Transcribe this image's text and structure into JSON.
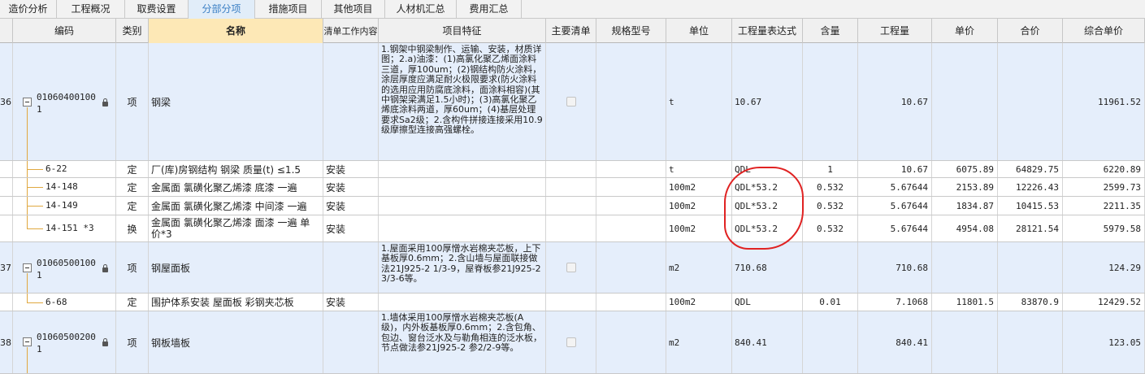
{
  "tabs": [
    {
      "label": "造价分析"
    },
    {
      "label": "工程概况"
    },
    {
      "label": "取费设置"
    },
    {
      "label": "分部分项"
    },
    {
      "label": "措施项目"
    },
    {
      "label": "其他项目"
    },
    {
      "label": "人材机汇总"
    },
    {
      "label": "费用汇总"
    }
  ],
  "grid": {
    "headers": {
      "code": "编码",
      "type": "类别",
      "name": "名称",
      "content": "清单工作内容",
      "feature": "项目特征",
      "main": "主要清单",
      "spec": "规格型号",
      "unit": "单位",
      "expr": "工程量表达式",
      "amount": "含量",
      "quantity": "工程量",
      "price": "单价",
      "total": "合价",
      "unit_total": "综合单价"
    },
    "rows": [
      {
        "seq": "36",
        "code1": "01060400100",
        "code2": "1",
        "type": "项",
        "name": "钢梁",
        "content": "",
        "feature": "1.钢架中钢梁制作、运输、安装，材质详图；2.a)油漆：(1)高氯化聚乙烯面涂料三道，厚100um；(2)钢结构防火涂料，涂层厚度应满足耐火极限要求(防火涂料的选用应用防腐底涂料，面涂料相容)(其中钢架梁满足1.5小时)；(3)高氯化聚乙烯底涂料两道，厚60um；(4)基层处理要求Sa2级；2.含构件拼接连接采用10.9级摩擦型连接高强螺栓。",
        "unit": "t",
        "expr": "10.67",
        "amount": "",
        "quantity": "10.67",
        "price": "",
        "total": "",
        "unit_total": "11961.52"
      },
      {
        "code": "6-22",
        "type": "定",
        "name": "厂(库)房钢结构 钢梁 质量(t) ≤1.5",
        "content": "安装",
        "unit": "t",
        "expr": "QDL",
        "amount": "1",
        "quantity": "10.67",
        "price": "6075.89",
        "total": "64829.75",
        "unit_total": "6220.89"
      },
      {
        "code": "14-148",
        "type": "定",
        "name": "金属面 氯磺化聚乙烯漆 底漆 一遍",
        "content": "安装",
        "unit": "100m2",
        "expr": "QDL*53.2",
        "amount": "0.532",
        "quantity": "5.67644",
        "price": "2153.89",
        "total": "12226.43",
        "unit_total": "2599.73"
      },
      {
        "code": "14-149",
        "type": "定",
        "name": "金属面 氯磺化聚乙烯漆 中间漆 一遍",
        "content": "安装",
        "unit": "100m2",
        "expr": "QDL*53.2",
        "amount": "0.532",
        "quantity": "5.67644",
        "price": "1834.87",
        "total": "10415.53",
        "unit_total": "2211.35"
      },
      {
        "code": "14-151 *3",
        "type": "换",
        "name1": "金属面 氯磺化聚乙烯漆 面漆 一遍 单",
        "name2": "价*3",
        "content": "安装",
        "unit": "100m2",
        "expr": "QDL*53.2",
        "amount": "0.532",
        "quantity": "5.67644",
        "price": "4954.08",
        "total": "28121.54",
        "unit_total": "5979.58"
      },
      {
        "seq": "37",
        "code1": "01060500100",
        "code2": "1",
        "type": "项",
        "name": "钢屋面板",
        "content": "",
        "feature": "1.屋面采用100厚憎水岩棉夹芯板，上下基板厚0.6mm；2.含山墙与屋面联接做法21J925-2 1/3-9，屋脊板参21J925-2 3/3-6等。",
        "unit": "m2",
        "expr": "710.68",
        "amount": "",
        "quantity": "710.68",
        "price": "",
        "total": "",
        "unit_total": "124.29"
      },
      {
        "code": "6-68",
        "type": "定",
        "name": "围护体系安装 屋面板 彩钢夹芯板",
        "content": "安装",
        "unit": "100m2",
        "expr": "QDL",
        "amount": "0.01",
        "quantity": "7.1068",
        "price": "11801.5",
        "total": "83870.9",
        "unit_total": "12429.52"
      },
      {
        "seq": "38",
        "code1": "01060500200",
        "code2": "1",
        "type": "项",
        "name": "钢板墙板",
        "content": "",
        "feature": "1.墙体采用100厚憎水岩棉夹芯板(A级)，内外板基板厚0.6mm；2.含包角、包边、窗台泛水及与勒角相连的泛水板，节点做法参21J925-2 参2/2-9等。",
        "unit": "m2",
        "expr": "840.41",
        "amount": "",
        "quantity": "840.41",
        "price": "",
        "total": "",
        "unit_total": "123.05"
      }
    ]
  },
  "colors": {
    "item_row": "#e5eefb",
    "active_tab": "#3a7fc4",
    "selected_header": "#fde8b6",
    "annotation": "#e02222"
  }
}
